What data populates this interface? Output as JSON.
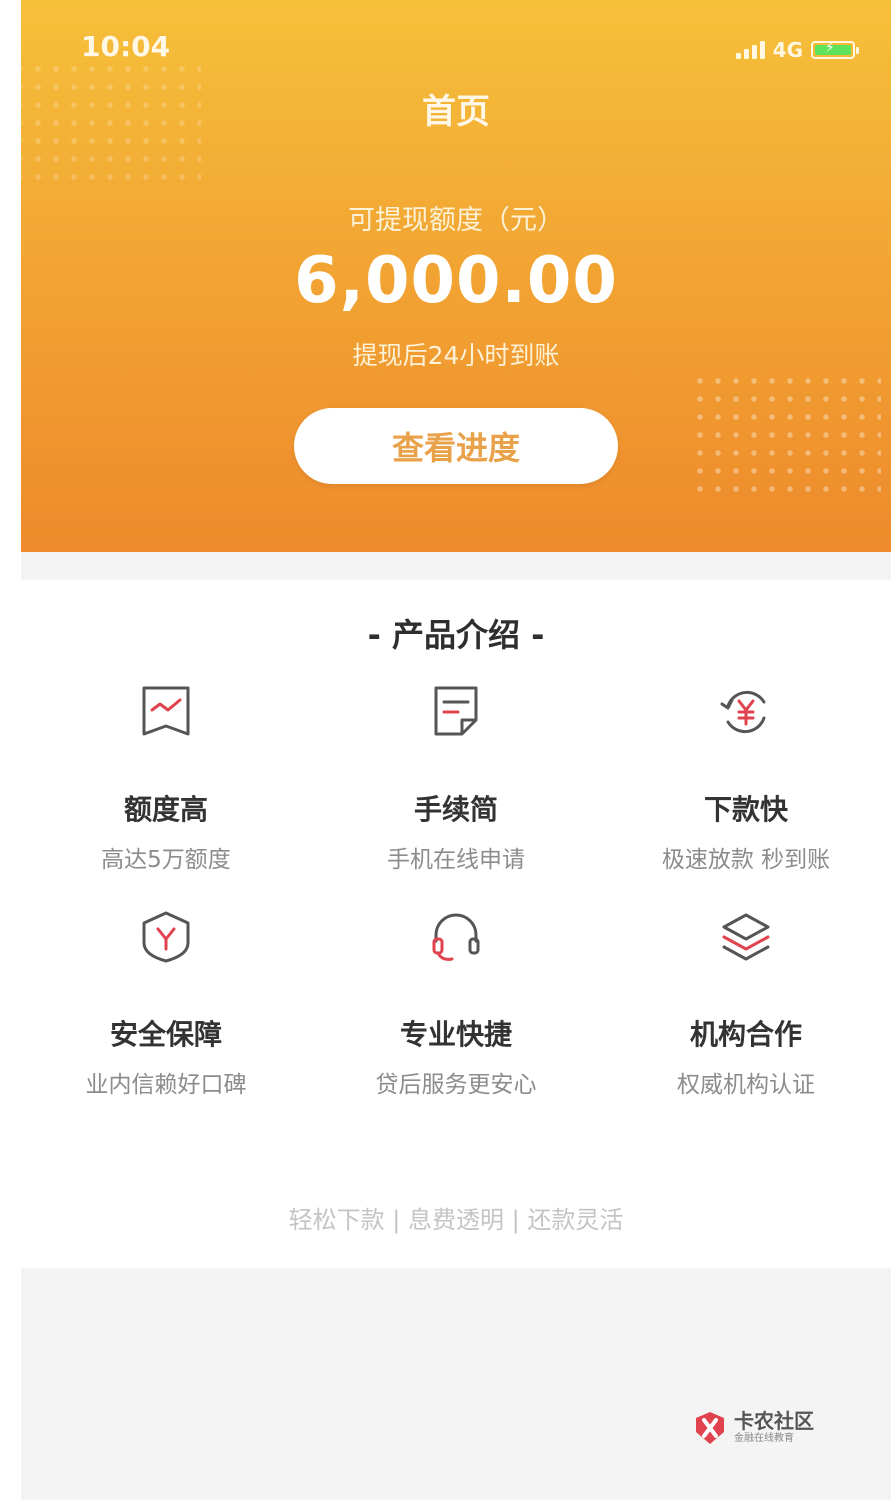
{
  "status_bar": {
    "time": "10:04",
    "network": "4G"
  },
  "header": {
    "title": "首页",
    "amount_label": "可提现额度（元）",
    "amount": "6,000.00",
    "arrival_note": "提现后24小时到账",
    "progress_button": "查看进度"
  },
  "products": {
    "section_title": "-  产品介绍  -",
    "items": [
      {
        "title": "额度高",
        "subtitle": "高达5万额度",
        "icon": "chart-flag-icon"
      },
      {
        "title": "手续简",
        "subtitle": "手机在线申请",
        "icon": "document-icon"
      },
      {
        "title": "下款快",
        "subtitle": "极速放款 秒到账",
        "icon": "yuan-refresh-icon"
      },
      {
        "title": "安全保障",
        "subtitle": "业内信赖好口碑",
        "icon": "shield-icon"
      },
      {
        "title": "专业快捷",
        "subtitle": "贷后服务更安心",
        "icon": "headset-icon"
      },
      {
        "title": "机构合作",
        "subtitle": "权威机构认证",
        "icon": "layers-icon"
      }
    ]
  },
  "slogan": "轻松下款 | 息费透明 | 还款灵活",
  "watermark": {
    "name": "卡农社区",
    "tagline": "金融在线教育"
  },
  "colors": {
    "header_top": "#f6c03a",
    "header_bottom": "#ee8a2c",
    "accent_red": "#e0434d",
    "button_text": "#e9a24a"
  }
}
